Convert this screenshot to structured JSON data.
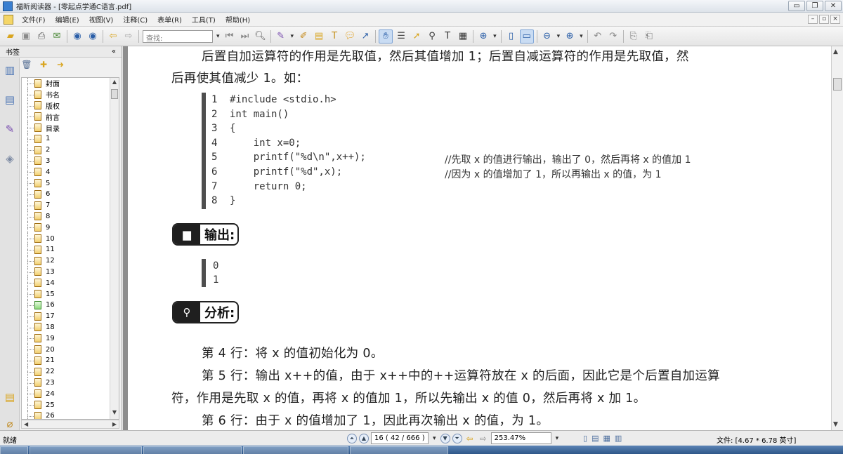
{
  "window": {
    "title": "福昕阅读器 - [零起点学通C语言.pdf]",
    "btn_minimize": "▭",
    "btn_restore": "❐",
    "btn_close": "✕"
  },
  "menu": {
    "items": [
      "文件(F)",
      "编辑(E)",
      "视图(V)",
      "注释(C)",
      "表单(R)",
      "工具(T)",
      "帮助(H)"
    ],
    "mdi_minimize": "–",
    "mdi_restore": "▫",
    "mdi_close": "×"
  },
  "toolbar": {
    "search_placeholder": "查找:"
  },
  "sidebar": {
    "title": "书签",
    "collapse": "«",
    "bookmarks": [
      "封面",
      "书名",
      "版权",
      "前言",
      "目录",
      "1",
      "2",
      "3",
      "4",
      "5",
      "6",
      "7",
      "8",
      "9",
      "10",
      "11",
      "12",
      "13",
      "14",
      "15",
      "16",
      "17",
      "18",
      "19",
      "20",
      "21",
      "22",
      "23",
      "24",
      "25",
      "26"
    ]
  },
  "document": {
    "para_top_1": "后置自加运算符的作用是先取值，然后其值增加 1；后置自减运算符的作用是先取值，然",
    "para_top_2": "后再使其值减少 1。如：",
    "code": [
      {
        "n": "1",
        "text": "#include <stdio.h>",
        "comment": ""
      },
      {
        "n": "2",
        "text": "int main()",
        "comment": ""
      },
      {
        "n": "3",
        "text": "{",
        "comment": ""
      },
      {
        "n": "4",
        "text": "    int x=0;",
        "comment": ""
      },
      {
        "n": "5",
        "text": "    printf(\"%d\\n\",x++);",
        "comment": "//先取 x 的值进行输出，输出了 0，然后再将 x 的值加 1"
      },
      {
        "n": "6",
        "text": "    printf(\"%d\",x);",
        "comment": "//因为 x 的值增加了 1，所以再输出 x 的值，为 1"
      },
      {
        "n": "7",
        "text": "    return 0;",
        "comment": ""
      },
      {
        "n": "8",
        "text": "}",
        "comment": ""
      }
    ],
    "output_label": "输出:",
    "output": [
      "0",
      "1"
    ],
    "analysis_label": "分析:",
    "analysis_1": "第 4 行：将 x 的值初始化为 0。",
    "analysis_2a": "第 5 行：输出 x++的值，由于 x++中的++运算符放在 x 的后面，因此它是个后置自加运算",
    "analysis_2b": "符，作用是先取 x 的值，再将 x 的值加 1，所以先输出 x 的值 0，然后再将 x 加 1。",
    "analysis_3": "第 6 行：由于 x 的值增加了 1，因此再次输出 x 的值，为 1。"
  },
  "status": {
    "ready": "就绪",
    "page": "16  ( 42 / 666 )",
    "zoom": "253.47%",
    "file_info": "文件: [4.67 * 6.78 英寸]"
  }
}
